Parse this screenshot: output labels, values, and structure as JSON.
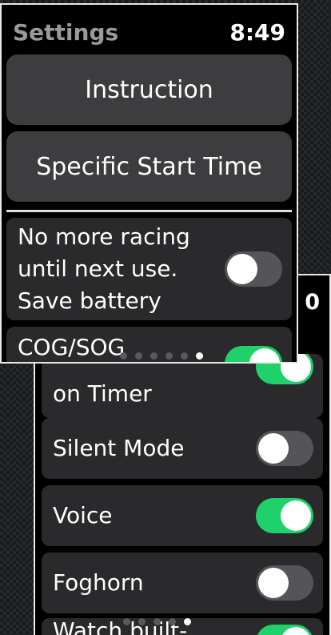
{
  "back_screen": {
    "clock_fragment": "0",
    "rows": [
      {
        "label": "on Timer",
        "on": true
      },
      {
        "label": "Silent Mode",
        "on": false
      },
      {
        "label": "Voice",
        "on": true
      },
      {
        "label": "Foghorn",
        "on": false
      },
      {
        "label": "Watch built-",
        "on": true
      }
    ],
    "page_dots": 5,
    "active_dot": 4
  },
  "front_screen": {
    "header": {
      "title": "Settings",
      "time": "8:49"
    },
    "buttons": {
      "instruction": "Instruction",
      "specific_start_time": "Specific Start Time"
    },
    "battery_row": {
      "label": "No more racing\nuntil next use.\nSave battery",
      "on": false
    },
    "cog_row": {
      "label": "COG/SOG",
      "on": true
    },
    "page_dots": 6,
    "active_dot": 5
  },
  "colors": {
    "toggle_on": "#1fd16a",
    "toggle_off": "#555559",
    "button_bg": "#3d3d40",
    "row_bg": "#2a2a2c"
  }
}
